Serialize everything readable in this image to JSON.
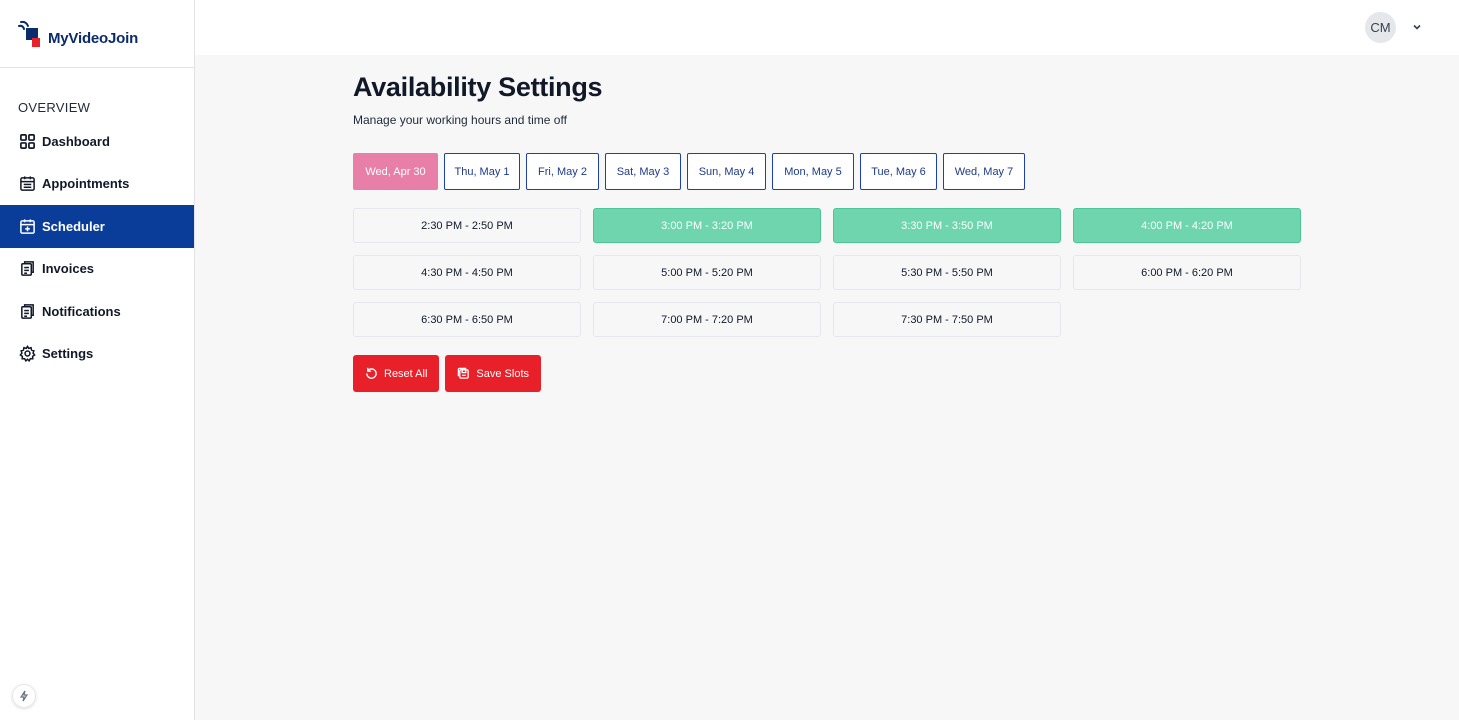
{
  "brand": {
    "name": "MyVideoJoin"
  },
  "sidebar": {
    "section_label": "OVERVIEW",
    "items": [
      {
        "label": "Dashboard",
        "icon": "grid-icon",
        "active": false
      },
      {
        "label": "Appointments",
        "icon": "calendar-icon",
        "active": false
      },
      {
        "label": "Scheduler",
        "icon": "calendar-plus-icon",
        "active": true
      },
      {
        "label": "Invoices",
        "icon": "invoice-icon",
        "active": false
      },
      {
        "label": "Notifications",
        "icon": "notification-icon",
        "active": false
      },
      {
        "label": "Settings",
        "icon": "gear-icon",
        "active": false
      }
    ]
  },
  "header": {
    "avatar_initials": "CM"
  },
  "main": {
    "title": "Availability Settings",
    "subtitle": "Manage your working hours and time off",
    "days": [
      {
        "label": "Wed, Apr 30",
        "selected": true
      },
      {
        "label": "Thu, May 1",
        "selected": false
      },
      {
        "label": "Fri, May 2",
        "selected": false
      },
      {
        "label": "Sat, May 3",
        "selected": false
      },
      {
        "label": "Sun, May 4",
        "selected": false
      },
      {
        "label": "Mon, May 5",
        "selected": false
      },
      {
        "label": "Tue, May 6",
        "selected": false
      },
      {
        "label": "Wed, May 7",
        "selected": false
      }
    ],
    "slots": [
      {
        "label": "2:30 PM - 2:50 PM",
        "selected": false
      },
      {
        "label": "3:00 PM - 3:20 PM",
        "selected": true
      },
      {
        "label": "3:30 PM - 3:50 PM",
        "selected": true
      },
      {
        "label": "4:00 PM - 4:20 PM",
        "selected": true
      },
      {
        "label": "4:30 PM - 4:50 PM",
        "selected": false
      },
      {
        "label": "5:00 PM - 5:20 PM",
        "selected": false
      },
      {
        "label": "5:30 PM - 5:50 PM",
        "selected": false
      },
      {
        "label": "6:00 PM - 6:20 PM",
        "selected": false
      },
      {
        "label": "6:30 PM - 6:50 PM",
        "selected": false
      },
      {
        "label": "7:00 PM - 7:20 PM",
        "selected": false
      },
      {
        "label": "7:30 PM - 7:50 PM",
        "selected": false
      }
    ],
    "actions": {
      "reset_label": "Reset All",
      "save_label": "Save Slots"
    }
  },
  "colors": {
    "brand_navy": "#0a3d9a",
    "selected_day": "#e87fa8",
    "selected_slot": "#6ed5ae",
    "danger": "#e8202a"
  }
}
